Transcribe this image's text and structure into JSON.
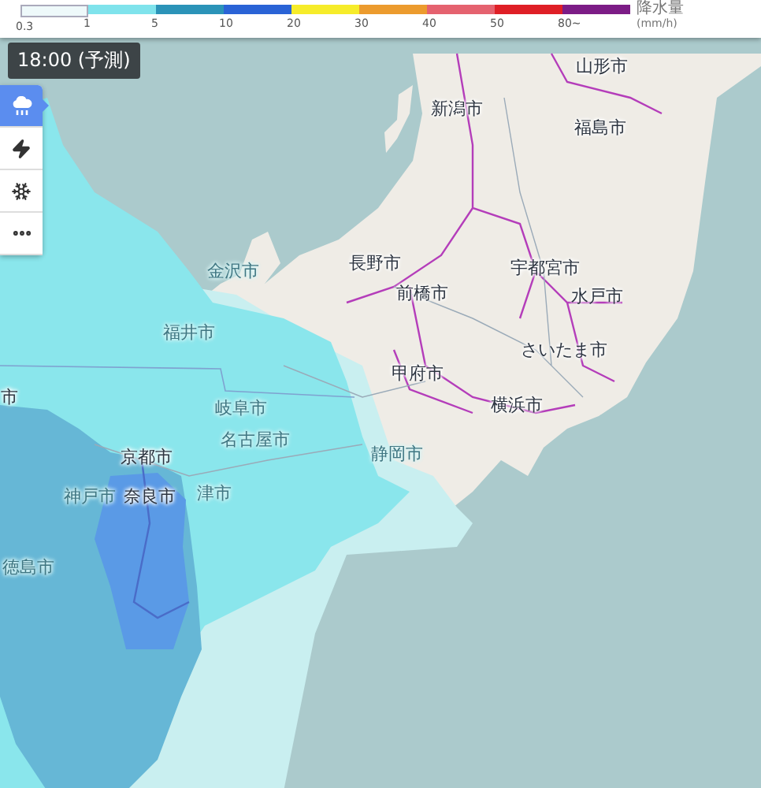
{
  "legend": {
    "items": [
      {
        "label": "0.3",
        "color": "#eef9fa"
      },
      {
        "label": "1",
        "color": "#7fe3ec"
      },
      {
        "label": "5",
        "color": "#2b93b8"
      },
      {
        "label": "10",
        "color": "#2a63d6"
      },
      {
        "label": "20",
        "color": "#f6ec2a"
      },
      {
        "label": "30",
        "color": "#ec9b2e"
      },
      {
        "label": "40",
        "color": "#e5626f"
      },
      {
        "label": "50",
        "color": "#df1f26"
      },
      {
        "label": "80~",
        "color": "#7c1c86"
      }
    ],
    "title": "降水量",
    "unit": "(mm/h)"
  },
  "time_badge": "18:00 (予測)",
  "layer_buttons": [
    {
      "kind": "rain",
      "selected": true
    },
    {
      "kind": "lightning",
      "selected": false
    },
    {
      "kind": "snow",
      "selected": false
    },
    {
      "kind": "more",
      "selected": false
    }
  ],
  "city_labels": [
    {
      "name": "山形市",
      "faded": false
    },
    {
      "name": "新潟市",
      "faded": false
    },
    {
      "name": "福島市",
      "faded": false
    },
    {
      "name": "長野市",
      "faded": false
    },
    {
      "name": "宇都宮市",
      "faded": false
    },
    {
      "name": "前橋市",
      "faded": false
    },
    {
      "name": "水戸市",
      "faded": false
    },
    {
      "name": "さいたま市",
      "faded": false
    },
    {
      "name": "甲府市",
      "faded": false
    },
    {
      "name": "横浜市",
      "faded": false
    },
    {
      "name": "静岡市",
      "faded": true
    },
    {
      "name": "金沢市",
      "faded": true
    },
    {
      "name": "福井市",
      "faded": true
    },
    {
      "name": "岐阜市",
      "faded": true
    },
    {
      "name": "名古屋市",
      "faded": true
    },
    {
      "name": "津市",
      "faded": true
    },
    {
      "name": "京都市",
      "faded": false
    },
    {
      "name": "神戸市",
      "faded": true
    },
    {
      "name": "奈良市",
      "faded": false
    },
    {
      "name": "徳島市",
      "faded": true
    },
    {
      "name": "市",
      "faded": false
    }
  ]
}
